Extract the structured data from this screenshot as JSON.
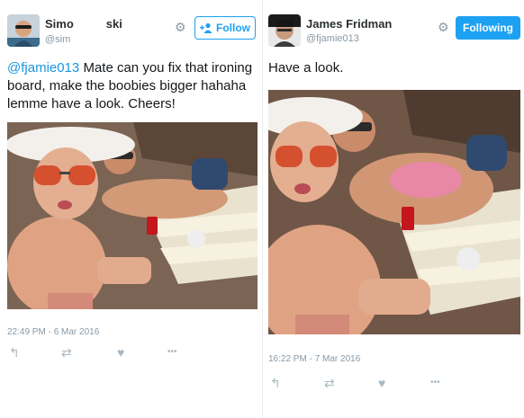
{
  "left_tweet": {
    "display_name": "Simo▇▇▇▇▇ski",
    "name_part_1": "Simo",
    "name_part_2": "ski",
    "handle": "@sim",
    "follow_label": "Follow",
    "mention": "@fjamie013",
    "body": " Mate can you fix that ironing board, make the boobies bigger hahaha lemme have a look. Cheers!",
    "timestamp": "22:49 PM - 6 Mar 2016"
  },
  "right_tweet": {
    "display_name": "James Fridman",
    "handle": "@fjamie013",
    "follow_label": "Following",
    "body": "Have a look.",
    "timestamp": "16:22 PM - 7 Mar 2016"
  },
  "icons": {
    "reply": "↰",
    "retweet": "⇄",
    "like": "♥",
    "more": "•••",
    "gear": "⚙",
    "follow_plus": "+👤"
  },
  "colors": {
    "accent": "#1da1f2",
    "mention": "#1b95e0",
    "muted": "#8899a6",
    "action_icon": "#aab8c2"
  }
}
